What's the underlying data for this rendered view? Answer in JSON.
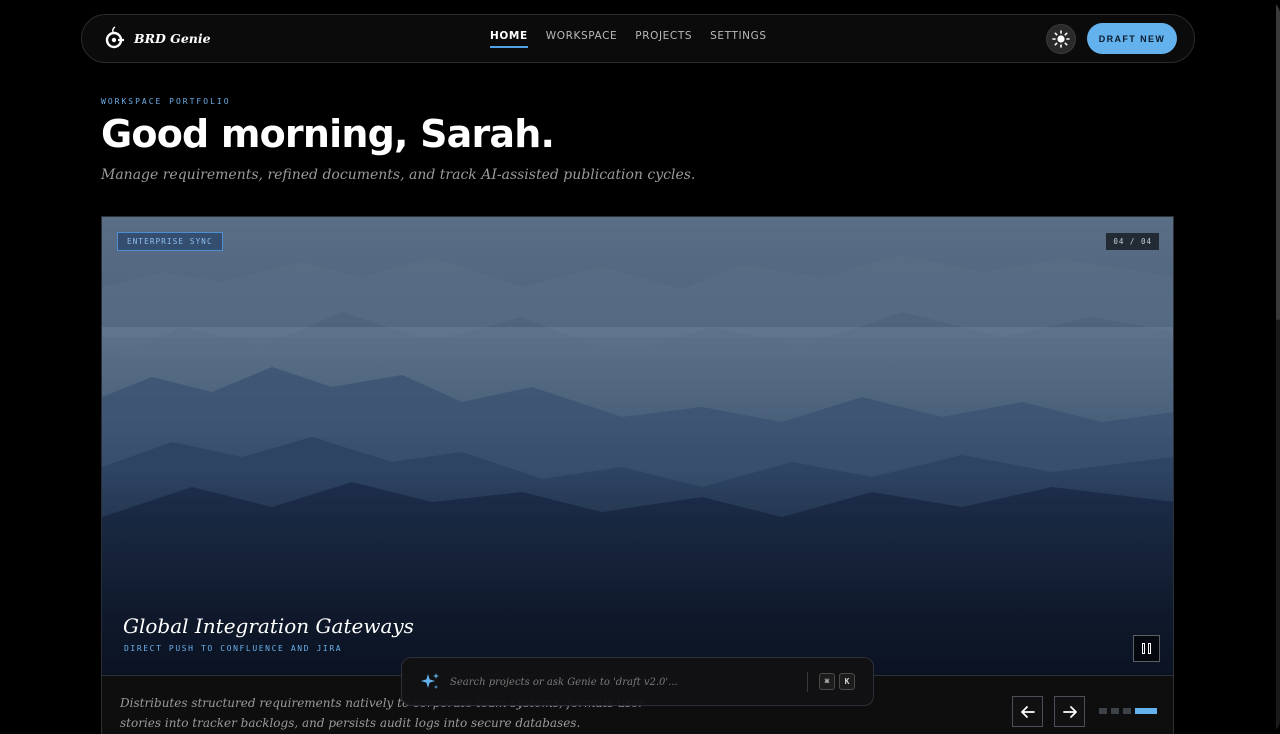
{
  "brand": {
    "name": "BRD Genie",
    "logo_icon": "genie-lamp-logo-icon"
  },
  "nav": {
    "links": [
      {
        "label": "HOME",
        "active": true
      },
      {
        "label": "WORKSPACE",
        "active": false
      },
      {
        "label": "PROJECTS",
        "active": false
      },
      {
        "label": "SETTINGS",
        "active": false
      }
    ],
    "theme_toggle_icon": "sun-icon",
    "draft_label": "DRAFT NEW"
  },
  "header": {
    "eyebrow": "WORKSPACE PORTFOLIO",
    "greeting": "Good morning, Sarah.",
    "subtitle": "Manage requirements, refined documents, and track AI-assisted publication cycles."
  },
  "hero": {
    "tag": "ENTERPRISE SYNC",
    "counter": "04 / 04",
    "title": "Global Integration Gateways",
    "subtitle": "DIRECT PUSH TO CONFLUENCE AND JIRA",
    "description": "Distributes structured requirements natively to corporate team systems, formats user stories into tracker backlogs, and persists audit logs into secure databases.",
    "slide_count": 4,
    "active_slide": 4
  },
  "search": {
    "placeholder": "Search projects or ask Genie to 'draft v2.0'...",
    "shortcut_keys": [
      "⌘",
      "K"
    ],
    "icon": "sparkle-icon"
  },
  "colors": {
    "accent": "#63b2ee",
    "accent_text": "#6aaee8",
    "background": "#000000"
  }
}
